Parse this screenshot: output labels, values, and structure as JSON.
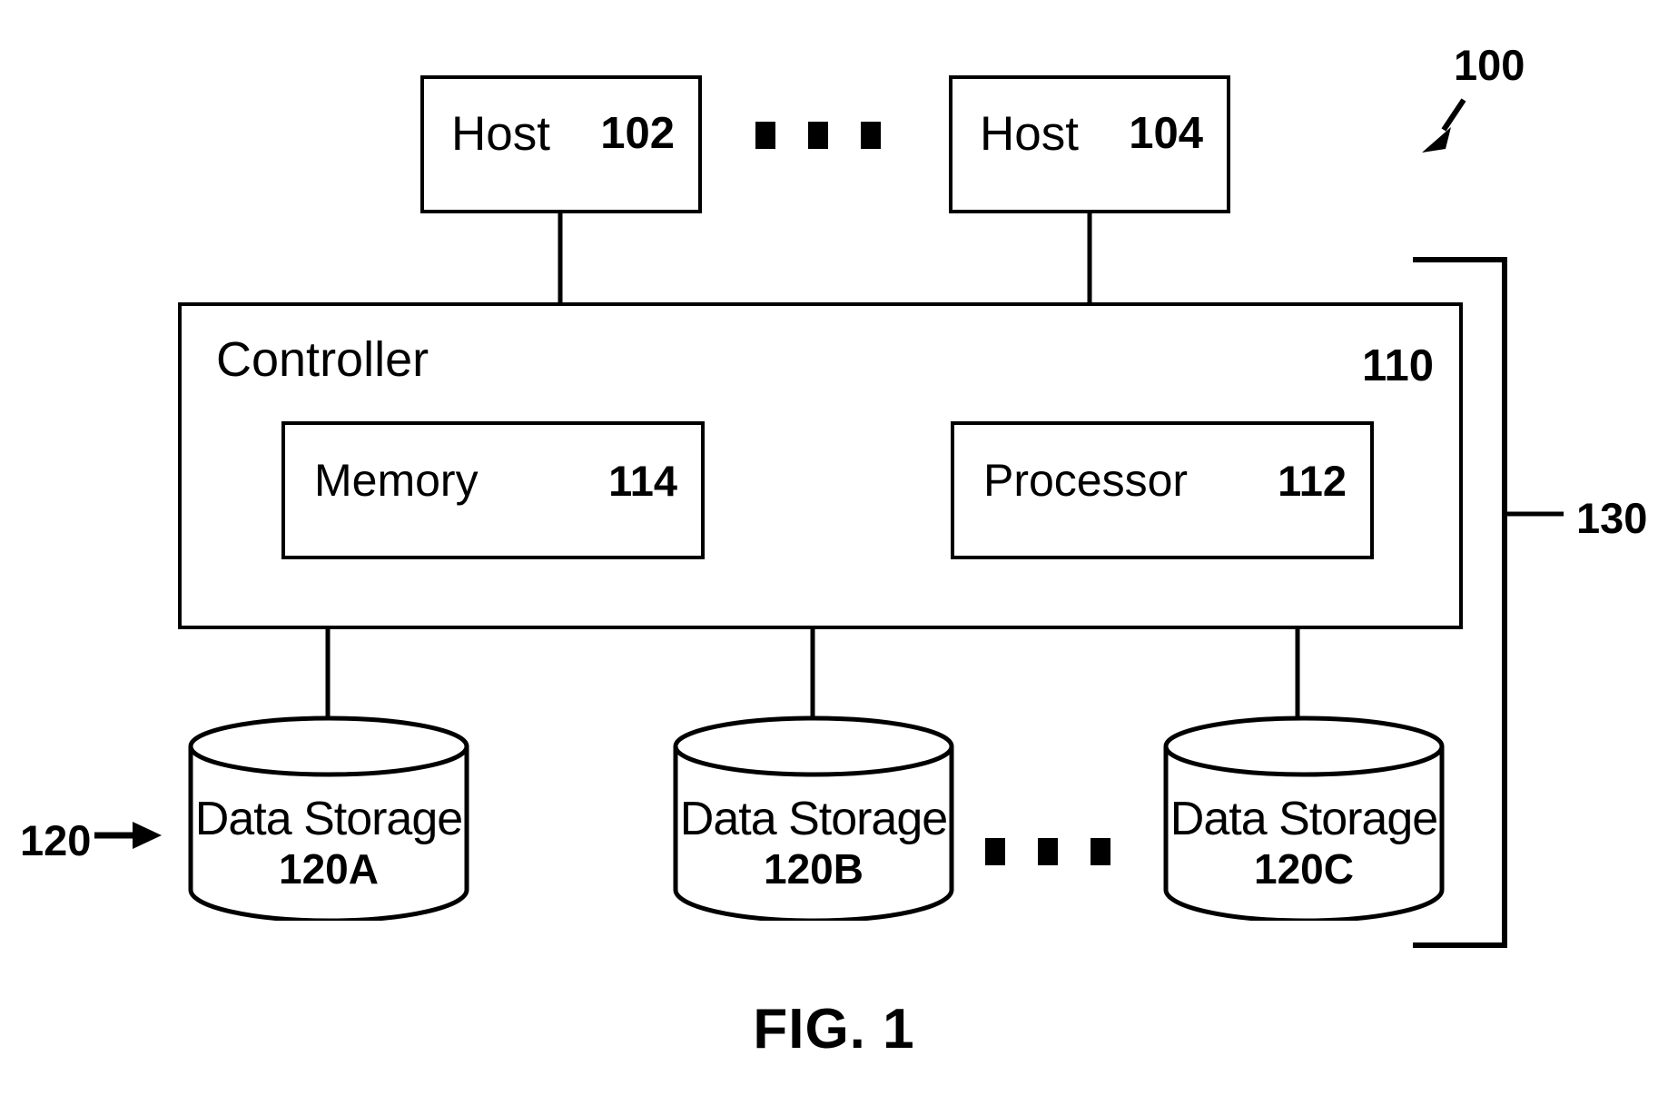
{
  "figure": {
    "caption": "FIG. 1",
    "system_ref": "100",
    "system_ref_arrow": "arrow pointing down-left",
    "storage_group_ref": "130",
    "storage_group_ref_leader": "leader line to bracket",
    "data_storage_group_ref": "120",
    "data_storage_group_ref_arrow": "arrow pointing right"
  },
  "hosts": [
    {
      "name": "Host",
      "ref": "102"
    },
    {
      "name": "Host",
      "ref": "104"
    }
  ],
  "host_ellipsis": [
    "square",
    "square",
    "square"
  ],
  "controller": {
    "name": "Controller",
    "ref": "110",
    "blocks": [
      {
        "name": "Memory",
        "ref": "114"
      },
      {
        "name": "Processor",
        "ref": "112"
      }
    ]
  },
  "data_storage": [
    {
      "name": "Data Storage",
      "ref": "120A"
    },
    {
      "name": "Data Storage",
      "ref": "120B"
    },
    {
      "name": "Data Storage",
      "ref": "120C"
    }
  ],
  "storage_ellipsis": [
    "square",
    "square",
    "square"
  ],
  "colors": {
    "line": "#000000",
    "background": "#ffffff"
  }
}
